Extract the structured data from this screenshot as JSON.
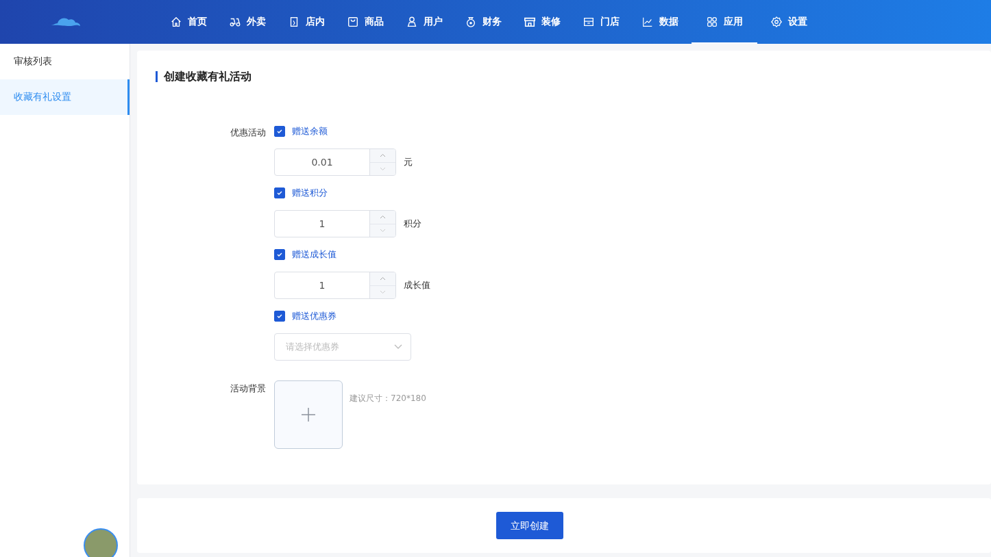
{
  "nav": [
    {
      "label": "首页",
      "kind": "home",
      "selected": false
    },
    {
      "label": "外卖",
      "kind": "scooter",
      "selected": false
    },
    {
      "label": "店内",
      "kind": "door",
      "selected": false
    },
    {
      "label": "商品",
      "kind": "bag",
      "selected": false
    },
    {
      "label": "用户",
      "kind": "user",
      "selected": false
    },
    {
      "label": "财务",
      "kind": "money",
      "selected": false
    },
    {
      "label": "装修",
      "kind": "store",
      "selected": false
    },
    {
      "label": "门店",
      "kind": "shop",
      "selected": false
    },
    {
      "label": "数据",
      "kind": "chart",
      "selected": false
    },
    {
      "label": "应用",
      "kind": "grid",
      "selected": true
    },
    {
      "label": "设置",
      "kind": "gear",
      "selected": false
    }
  ],
  "sidebar": {
    "items": [
      {
        "label": "审核列表",
        "selected": false
      },
      {
        "label": "收藏有礼设置",
        "selected": true
      }
    ]
  },
  "form": {
    "title": "创建收藏有礼活动",
    "rewards_label": "优惠活动",
    "rewards": [
      {
        "label": "赠送余额",
        "checked": true,
        "kind": "number",
        "value": "0.01",
        "unit": "元"
      },
      {
        "label": "赠送积分",
        "checked": true,
        "kind": "number",
        "value": "1",
        "unit": "积分"
      },
      {
        "label": "赠送成长值",
        "checked": true,
        "kind": "number",
        "value": "1",
        "unit": "成长值"
      },
      {
        "label": "赠送优惠券",
        "checked": true,
        "kind": "select",
        "placeholder": "请选择优惠券"
      }
    ],
    "background_label": "活动背景",
    "background_hint": "建议尺寸：720*180"
  },
  "submit_button": "立即创建"
}
